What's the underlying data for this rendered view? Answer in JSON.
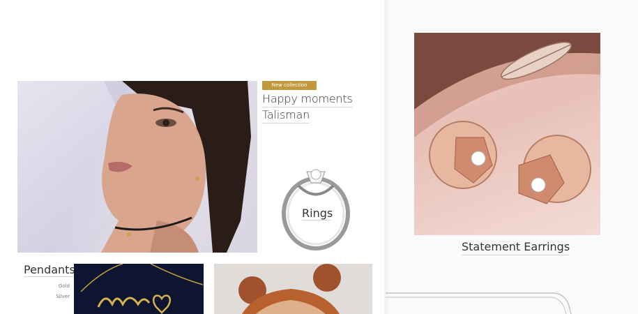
{
  "collection": {
    "badge": "New collection",
    "lines": [
      "Happy moments",
      "Talisman"
    ]
  },
  "rings": {
    "label": "Rings"
  },
  "pendants": {
    "title": "Pendants",
    "options": [
      "Gold",
      "Silver"
    ]
  },
  "earrings": {
    "label": "Statement Earrings"
  },
  "colors": {
    "badge_gold": "#c1993c",
    "necklace_bg": "#0d1530",
    "earring_bg": "#ecc9c1"
  }
}
